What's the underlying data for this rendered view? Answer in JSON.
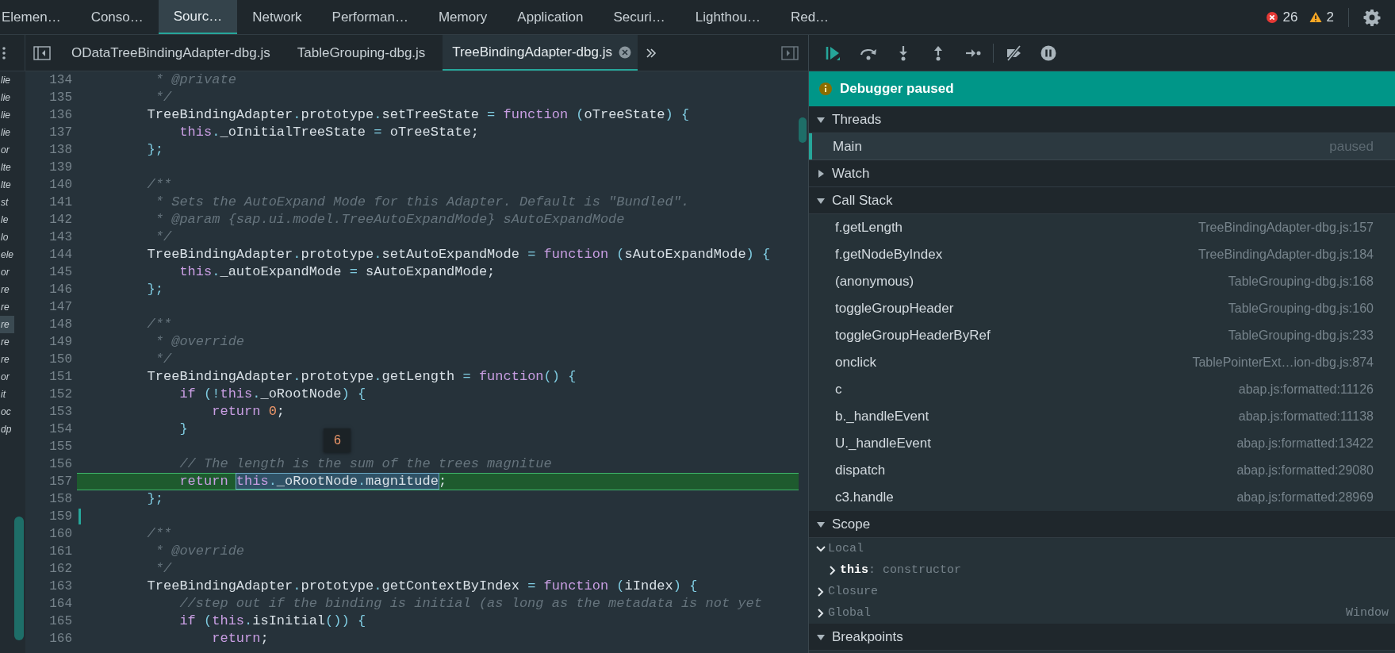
{
  "main_tabs": [
    {
      "label": "Elemen…",
      "selected": false
    },
    {
      "label": "Conso…",
      "selected": false
    },
    {
      "label": "Sourc…",
      "selected": true
    },
    {
      "label": "Network",
      "selected": false
    },
    {
      "label": "Performan…",
      "selected": false
    },
    {
      "label": "Memory",
      "selected": false
    },
    {
      "label": "Application",
      "selected": false
    },
    {
      "label": "Securi…",
      "selected": false
    },
    {
      "label": "Lighthou…",
      "selected": false
    },
    {
      "label": "Red…",
      "selected": false
    }
  ],
  "console_counts": {
    "errors": "26",
    "warnings": "2"
  },
  "navigator": {
    "items": [
      {
        "label": "lie",
        "selected": false
      },
      {
        "label": "lie",
        "selected": false
      },
      {
        "label": "lie",
        "selected": false
      },
      {
        "label": "lie",
        "selected": false
      },
      {
        "label": "or",
        "selected": false
      },
      {
        "label": "lte",
        "selected": false
      },
      {
        "label": "lte",
        "selected": false
      },
      {
        "label": "st",
        "selected": false
      },
      {
        "label": "le",
        "selected": false
      },
      {
        "label": "lo",
        "selected": false
      },
      {
        "label": "ele",
        "selected": false
      },
      {
        "label": "or",
        "selected": false
      },
      {
        "label": "re",
        "selected": false
      },
      {
        "label": "re",
        "selected": false
      },
      {
        "label": "re",
        "selected": true
      },
      {
        "label": "re",
        "selected": false
      },
      {
        "label": "re",
        "selected": false
      },
      {
        "label": "or",
        "selected": false
      },
      {
        "label": "it",
        "selected": false
      },
      {
        "label": "oc",
        "selected": false
      },
      {
        "label": "dp",
        "selected": false
      }
    ]
  },
  "file_tabs": [
    {
      "label": "ODataTreeBindingAdapter-dbg.js",
      "selected": false
    },
    {
      "label": "TableGrouping-dbg.js",
      "selected": false
    },
    {
      "label": "TreeBindingAdapter-dbg.js",
      "selected": true
    }
  ],
  "editor": {
    "lines": [
      {
        "number": "134",
        "current": false,
        "cursor": false,
        "tokens": [
          {
            "kind": "comment",
            "text": "         * @private"
          }
        ]
      },
      {
        "number": "135",
        "current": false,
        "cursor": false,
        "tokens": [
          {
            "kind": "comment",
            "text": "         */"
          }
        ]
      },
      {
        "number": "136",
        "current": false,
        "cursor": false,
        "tokens": [
          {
            "kind": "plain",
            "text": "        TreeBindingAdapter"
          },
          {
            "kind": "punct",
            "text": "."
          },
          {
            "kind": "plain",
            "text": "prototype"
          },
          {
            "kind": "punct",
            "text": "."
          },
          {
            "kind": "plain",
            "text": "setTreeState "
          },
          {
            "kind": "punct",
            "text": "= "
          },
          {
            "kind": "kw",
            "text": "function "
          },
          {
            "kind": "punct",
            "text": "("
          },
          {
            "kind": "plain",
            "text": "oTreeState"
          },
          {
            "kind": "punct",
            "text": ") {"
          }
        ]
      },
      {
        "number": "137",
        "current": false,
        "cursor": false,
        "tokens": [
          {
            "kind": "kw",
            "text": "            this"
          },
          {
            "kind": "punct",
            "text": "."
          },
          {
            "kind": "plain",
            "text": "_oInitialTreeState "
          },
          {
            "kind": "punct",
            "text": "= "
          },
          {
            "kind": "plain",
            "text": "oTreeState;"
          }
        ]
      },
      {
        "number": "138",
        "current": false,
        "cursor": false,
        "tokens": [
          {
            "kind": "punct",
            "text": "        };"
          }
        ]
      },
      {
        "number": "139",
        "current": false,
        "cursor": false
      },
      {
        "number": "140",
        "current": false,
        "cursor": false,
        "tokens": [
          {
            "kind": "comment",
            "text": "        /**"
          }
        ]
      },
      {
        "number": "141",
        "current": false,
        "cursor": false,
        "tokens": [
          {
            "kind": "comment",
            "text": "         * Sets the AutoExpand Mode for this Adapter. Default is \"Bundled\"."
          }
        ]
      },
      {
        "number": "142",
        "current": false,
        "cursor": false,
        "tokens": [
          {
            "kind": "comment",
            "text": "         * @param {sap.ui.model.TreeAutoExpandMode} sAutoExpandMode"
          }
        ]
      },
      {
        "number": "143",
        "current": false,
        "cursor": false,
        "tokens": [
          {
            "kind": "comment",
            "text": "         */"
          }
        ]
      },
      {
        "number": "144",
        "current": false,
        "cursor": false,
        "tokens": [
          {
            "kind": "plain",
            "text": "        TreeBindingAdapter"
          },
          {
            "kind": "punct",
            "text": "."
          },
          {
            "kind": "plain",
            "text": "prototype"
          },
          {
            "kind": "punct",
            "text": "."
          },
          {
            "kind": "plain",
            "text": "setAutoExpandMode "
          },
          {
            "kind": "punct",
            "text": "= "
          },
          {
            "kind": "kw",
            "text": "function "
          },
          {
            "kind": "punct",
            "text": "("
          },
          {
            "kind": "plain",
            "text": "sAutoExpandMode"
          },
          {
            "kind": "punct",
            "text": ") {"
          }
        ]
      },
      {
        "number": "145",
        "current": false,
        "cursor": false,
        "tokens": [
          {
            "kind": "kw",
            "text": "            this"
          },
          {
            "kind": "punct",
            "text": "."
          },
          {
            "kind": "plain",
            "text": "_autoExpandMode "
          },
          {
            "kind": "punct",
            "text": "= "
          },
          {
            "kind": "plain",
            "text": "sAutoExpandMode;"
          }
        ]
      },
      {
        "number": "146",
        "current": false,
        "cursor": false,
        "tokens": [
          {
            "kind": "punct",
            "text": "        };"
          }
        ]
      },
      {
        "number": "147",
        "current": false,
        "cursor": false
      },
      {
        "number": "148",
        "current": false,
        "cursor": false,
        "tokens": [
          {
            "kind": "comment",
            "text": "        /**"
          }
        ]
      },
      {
        "number": "149",
        "current": false,
        "cursor": false,
        "tokens": [
          {
            "kind": "comment",
            "text": "         * @override"
          }
        ]
      },
      {
        "number": "150",
        "current": false,
        "cursor": false,
        "tokens": [
          {
            "kind": "comment",
            "text": "         */"
          }
        ]
      },
      {
        "number": "151",
        "current": false,
        "cursor": false,
        "tokens": [
          {
            "kind": "plain",
            "text": "        TreeBindingAdapter"
          },
          {
            "kind": "punct",
            "text": "."
          },
          {
            "kind": "plain",
            "text": "prototype"
          },
          {
            "kind": "punct",
            "text": "."
          },
          {
            "kind": "plain",
            "text": "getLength "
          },
          {
            "kind": "punct",
            "text": "= "
          },
          {
            "kind": "kw",
            "text": "function"
          },
          {
            "kind": "punct",
            "text": "() {"
          }
        ]
      },
      {
        "number": "152",
        "current": false,
        "cursor": false,
        "tokens": [
          {
            "kind": "kw",
            "text": "            if "
          },
          {
            "kind": "punct",
            "text": "(!"
          },
          {
            "kind": "kw",
            "text": "this"
          },
          {
            "kind": "punct",
            "text": "."
          },
          {
            "kind": "plain",
            "text": "_oRootNode"
          },
          {
            "kind": "punct",
            "text": ") {"
          }
        ]
      },
      {
        "number": "153",
        "current": false,
        "cursor": false,
        "tokens": [
          {
            "kind": "kw",
            "text": "                return "
          },
          {
            "kind": "num",
            "text": "0"
          },
          {
            "kind": "plain",
            "text": ";"
          }
        ]
      },
      {
        "number": "154",
        "current": false,
        "cursor": false,
        "tokens": [
          {
            "kind": "punct",
            "text": "            }"
          }
        ]
      },
      {
        "number": "155",
        "current": false,
        "cursor": false
      },
      {
        "number": "156",
        "current": false,
        "cursor": false,
        "tokens": [
          {
            "kind": "comment",
            "text": "            // The length is the sum of the trees magnitue"
          }
        ]
      },
      {
        "number": "157",
        "current": true,
        "cursor": false,
        "tokens": [
          {
            "kind": "kw",
            "text": "            return "
          },
          {
            "kind": "selection",
            "hover_value": "6",
            "tokens": [
              {
                "kind": "kw",
                "text": "this"
              },
              {
                "kind": "punct",
                "text": "."
              },
              {
                "kind": "plain",
                "text": "_oRootNode"
              },
              {
                "kind": "punct",
                "text": "."
              },
              {
                "kind": "plain",
                "text": "magnitude"
              }
            ]
          },
          {
            "kind": "plain",
            "text": ";"
          }
        ]
      },
      {
        "number": "158",
        "current": false,
        "cursor": false,
        "tokens": [
          {
            "kind": "punct",
            "text": "        };"
          }
        ]
      },
      {
        "number": "159",
        "current": false,
        "cursor": true
      },
      {
        "number": "160",
        "current": false,
        "cursor": false,
        "tokens": [
          {
            "kind": "comment",
            "text": "        /**"
          }
        ]
      },
      {
        "number": "161",
        "current": false,
        "cursor": false,
        "tokens": [
          {
            "kind": "comment",
            "text": "         * @override"
          }
        ]
      },
      {
        "number": "162",
        "current": false,
        "cursor": false,
        "tokens": [
          {
            "kind": "comment",
            "text": "         */"
          }
        ]
      },
      {
        "number": "163",
        "current": false,
        "cursor": false,
        "tokens": [
          {
            "kind": "plain",
            "text": "        TreeBindingAdapter"
          },
          {
            "kind": "punct",
            "text": "."
          },
          {
            "kind": "plain",
            "text": "prototype"
          },
          {
            "kind": "punct",
            "text": "."
          },
          {
            "kind": "plain",
            "text": "getContextByIndex "
          },
          {
            "kind": "punct",
            "text": "= "
          },
          {
            "kind": "kw",
            "text": "function "
          },
          {
            "kind": "punct",
            "text": "("
          },
          {
            "kind": "plain",
            "text": "iIndex"
          },
          {
            "kind": "punct",
            "text": ") {"
          }
        ]
      },
      {
        "number": "164",
        "current": false,
        "cursor": false,
        "tokens": [
          {
            "kind": "comment",
            "text": "            //step out if the binding is initial (as long as the metadata is not yet"
          }
        ]
      },
      {
        "number": "165",
        "current": false,
        "cursor": false,
        "tokens": [
          {
            "kind": "kw",
            "text": "            if "
          },
          {
            "kind": "punct",
            "text": "("
          },
          {
            "kind": "kw",
            "text": "this"
          },
          {
            "kind": "punct",
            "text": "."
          },
          {
            "kind": "plain",
            "text": "isInitial"
          },
          {
            "kind": "punct",
            "text": "()) {"
          }
        ]
      },
      {
        "number": "166",
        "current": false,
        "cursor": false,
        "tokens": [
          {
            "kind": "kw",
            "text": "                return"
          },
          {
            "kind": "plain",
            "text": ";"
          }
        ]
      }
    ]
  },
  "debugger": {
    "banner": "Debugger paused",
    "sections": [
      {
        "kind": "threads",
        "title": "Threads",
        "expanded": true,
        "items": [
          {
            "name": "Main",
            "status": "paused",
            "selected": true
          }
        ]
      },
      {
        "kind": "watch",
        "title": "Watch",
        "expanded": false
      },
      {
        "kind": "frames",
        "title": "Call Stack",
        "expanded": true,
        "items": [
          {
            "name": "f.getLength",
            "location": "TreeBindingAdapter-dbg.js:157"
          },
          {
            "name": "f.getNodeByIndex",
            "location": "TreeBindingAdapter-dbg.js:184"
          },
          {
            "name": "(anonymous)",
            "location": "TableGrouping-dbg.js:168"
          },
          {
            "name": "toggleGroupHeader",
            "location": "TableGrouping-dbg.js:160"
          },
          {
            "name": "toggleGroupHeaderByRef",
            "location": "TableGrouping-dbg.js:233"
          },
          {
            "name": "onclick",
            "location": "TablePointerExt…ion-dbg.js:874"
          },
          {
            "name": "c",
            "location": "abap.js:formatted:11126"
          },
          {
            "name": "b._handleEvent",
            "location": "abap.js:formatted:11138"
          },
          {
            "name": "U._handleEvent",
            "location": "abap.js:formatted:13422"
          },
          {
            "name": "dispatch",
            "location": "abap.js:formatted:29080"
          },
          {
            "name": "c3.handle",
            "location": "abap.js:formatted:28969"
          }
        ]
      },
      {
        "kind": "scope",
        "title": "Scope",
        "expanded": true,
        "items": [
          {
            "label": "Local",
            "expanded": true,
            "children": [
              {
                "text": "**this**: constructor",
                "expanded": false
              }
            ]
          },
          {
            "label": "Closure",
            "expanded": false
          },
          {
            "label": "Global",
            "value": "Window",
            "expanded": false
          }
        ]
      },
      {
        "kind": "breakpoints",
        "title": "Breakpoints",
        "expanded": true
      }
    ]
  }
}
